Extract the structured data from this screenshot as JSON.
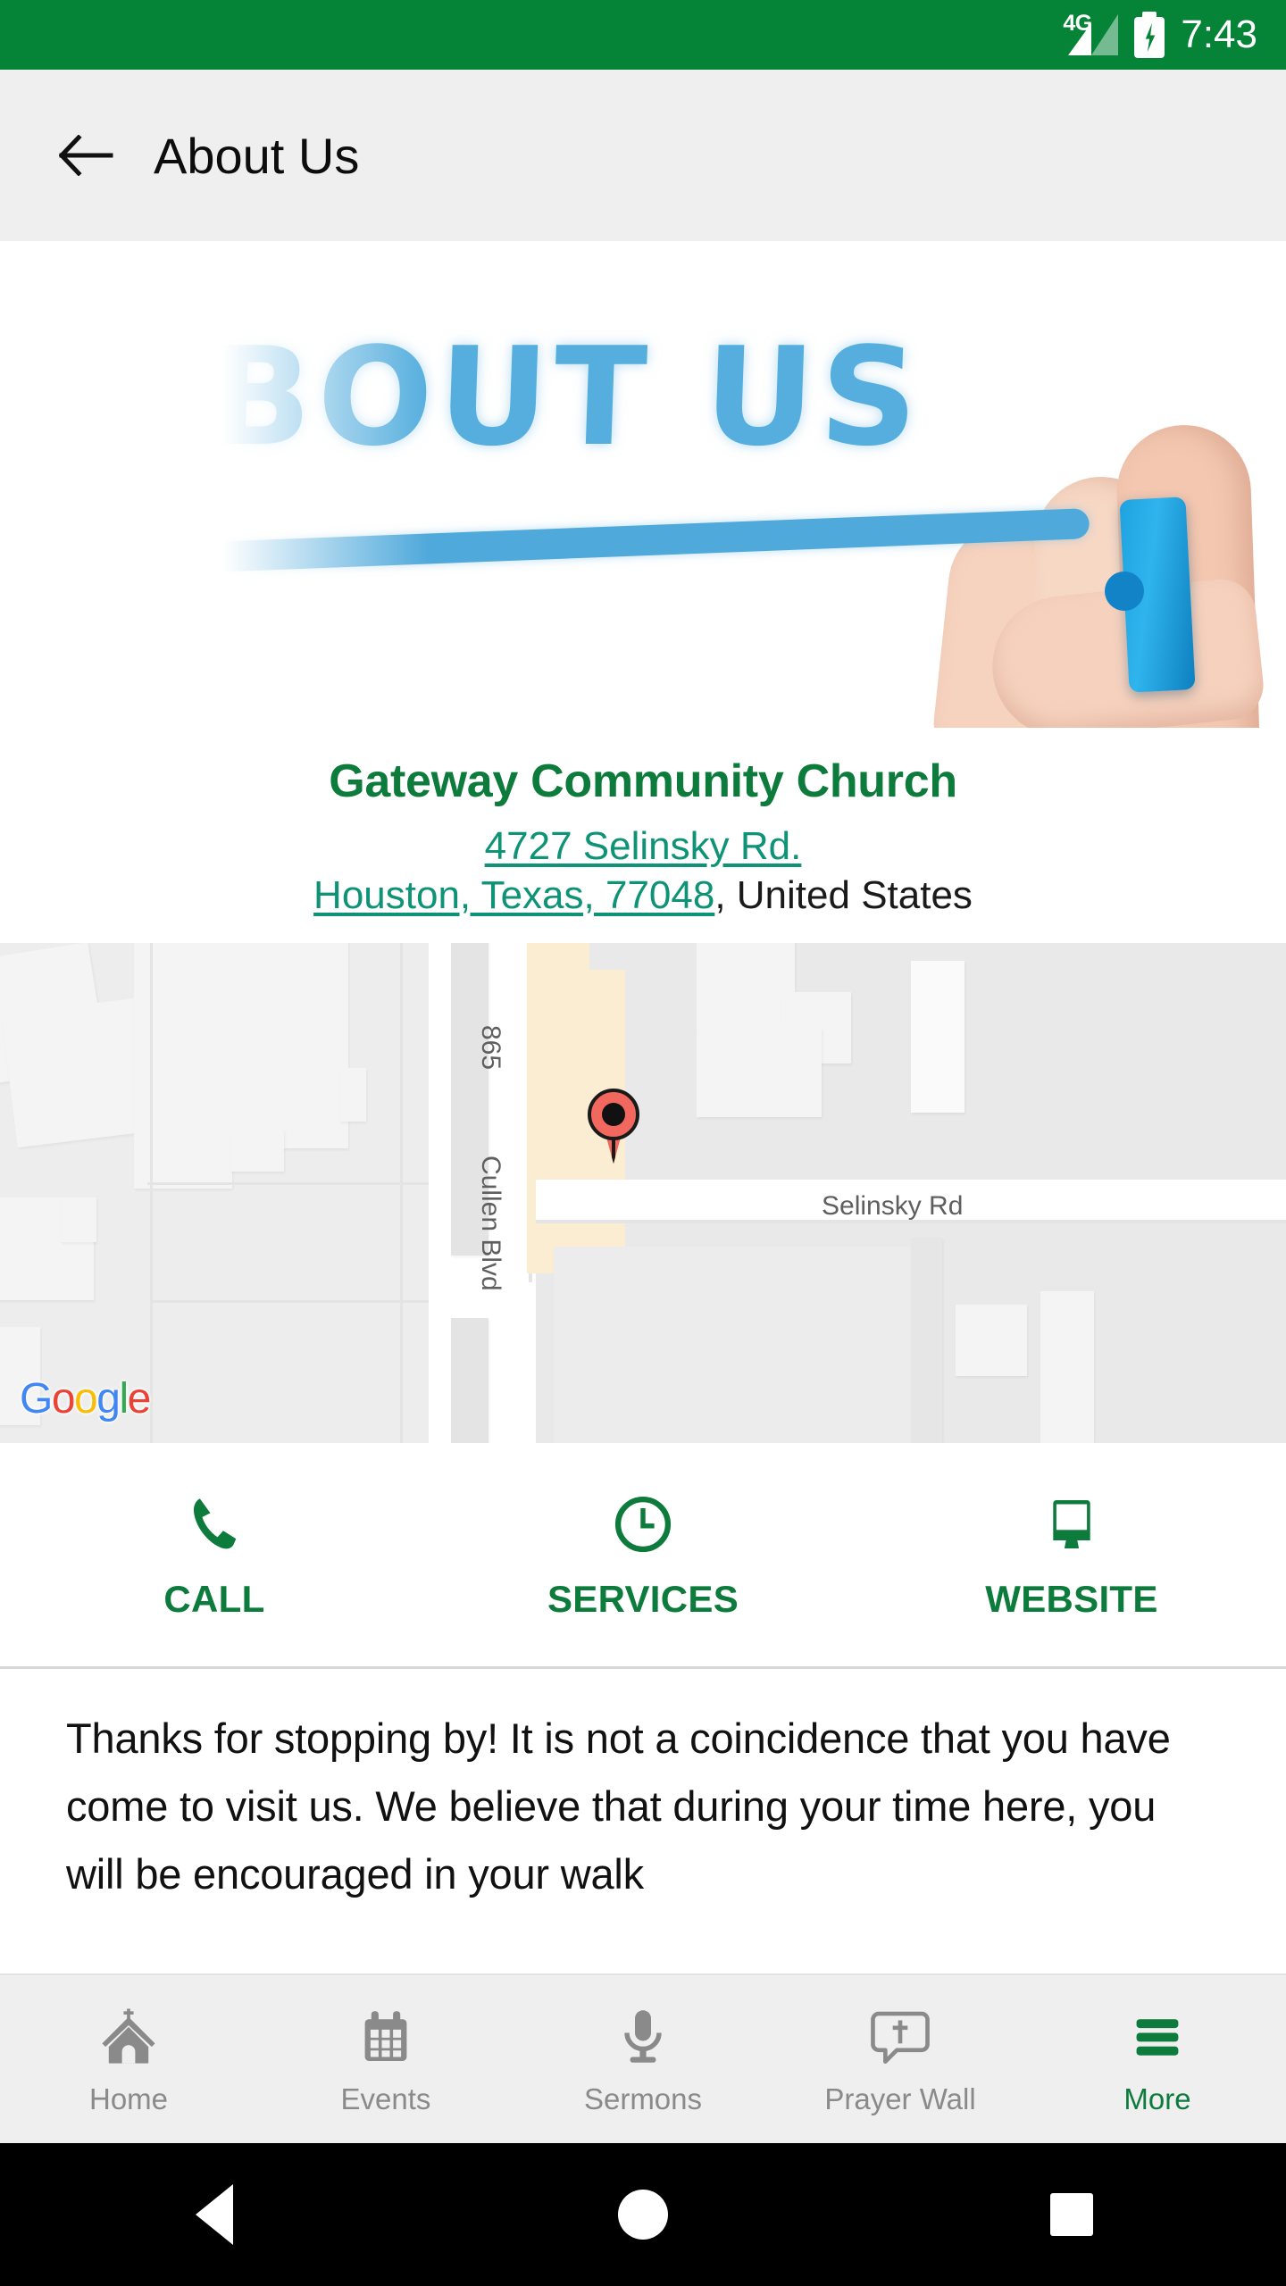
{
  "status_bar": {
    "network_type": "4G",
    "time": "7:43",
    "battery_state": "charging",
    "background_color": "#058337"
  },
  "app_bar": {
    "back_icon": "back-arrow-icon",
    "title": "About Us",
    "background_color": "#efefef"
  },
  "hero": {
    "headline": "ABOUT US",
    "alt": "hand drawing ABOUT US with a blue marker",
    "text_color": "#55AEDE"
  },
  "organization": {
    "name": "Gateway Community Church",
    "name_color": "#0D7B3C",
    "address_street": "4727 Selinsky Rd.",
    "address_city_state_zip": "Houston, Texas, 77048",
    "address_country": ", United States",
    "link_color": "#0E9377"
  },
  "map": {
    "provider_logo": "Google",
    "logo_letters": [
      "G",
      "o",
      "o",
      "g",
      "l",
      "e"
    ],
    "marker_color": "#F2685E",
    "labels": {
      "highway": "865",
      "cross_street": "Cullen Blvd",
      "street": "Selinsky Rd"
    }
  },
  "actions": [
    {
      "label": "CALL",
      "icon": "phone-icon"
    },
    {
      "label": "SERVICES",
      "icon": "clock-icon"
    },
    {
      "label": "WEBSITE",
      "icon": "monitor-icon"
    }
  ],
  "body": {
    "paragraph": "Thanks for stopping by!  It is not a coincidence that you have come to visit us.  We believe that during your time here, you will be encouraged in your walk"
  },
  "bottom_nav": {
    "items": [
      {
        "label": "Home",
        "icon": "church-icon",
        "active": false
      },
      {
        "label": "Events",
        "icon": "calendar-icon",
        "active": false
      },
      {
        "label": "Sermons",
        "icon": "microphone-icon",
        "active": false
      },
      {
        "label": "Prayer Wall",
        "icon": "prayer-bubble-icon",
        "active": false
      },
      {
        "label": "More",
        "icon": "hamburger-menu-icon",
        "active": true
      }
    ],
    "active_color": "#0D7B3C",
    "inactive_color": "#8A8A8A"
  },
  "system_nav": {
    "back": "system-back-button",
    "home": "system-home-button",
    "recents": "system-recents-button"
  }
}
